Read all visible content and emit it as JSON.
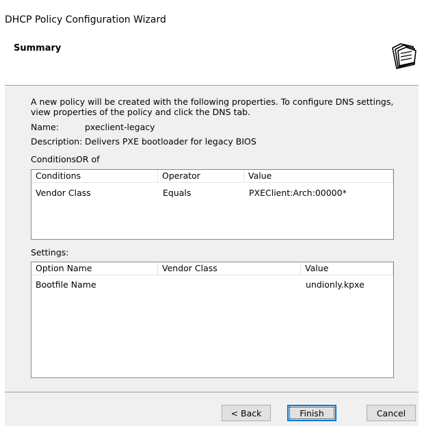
{
  "window": {
    "title": "DHCP Policy Configuration Wizard"
  },
  "header": {
    "title": "Summary",
    "icon": "folders-icon"
  },
  "intro": {
    "line1": "A new policy will be created with the following properties. To configure DNS settings,",
    "line2": "view properties of the policy and click the DNS tab."
  },
  "properties": {
    "name_label": "Name:",
    "name_value": "pxeclient-legacy",
    "description_label": "Description:",
    "description_value": "Delivers PXE bootloader for legacy BIOS",
    "conditions_label": "Conditions:",
    "conditions_value": "OR of"
  },
  "conditions_table": {
    "columns": [
      "Conditions",
      "Operator",
      "Value"
    ],
    "rows": [
      {
        "condition": "Vendor Class",
        "operator": "Equals",
        "value": "PXEClient:Arch:00000*"
      }
    ]
  },
  "settings": {
    "label": "Settings:",
    "columns": [
      "Option Name",
      "Vendor Class",
      "Value"
    ],
    "rows": [
      {
        "option_name": "Bootfile Name",
        "vendor_class": "",
        "value": "undionly.kpxe"
      }
    ]
  },
  "buttons": {
    "back": "< Back",
    "finish": "Finish",
    "cancel": "Cancel"
  }
}
